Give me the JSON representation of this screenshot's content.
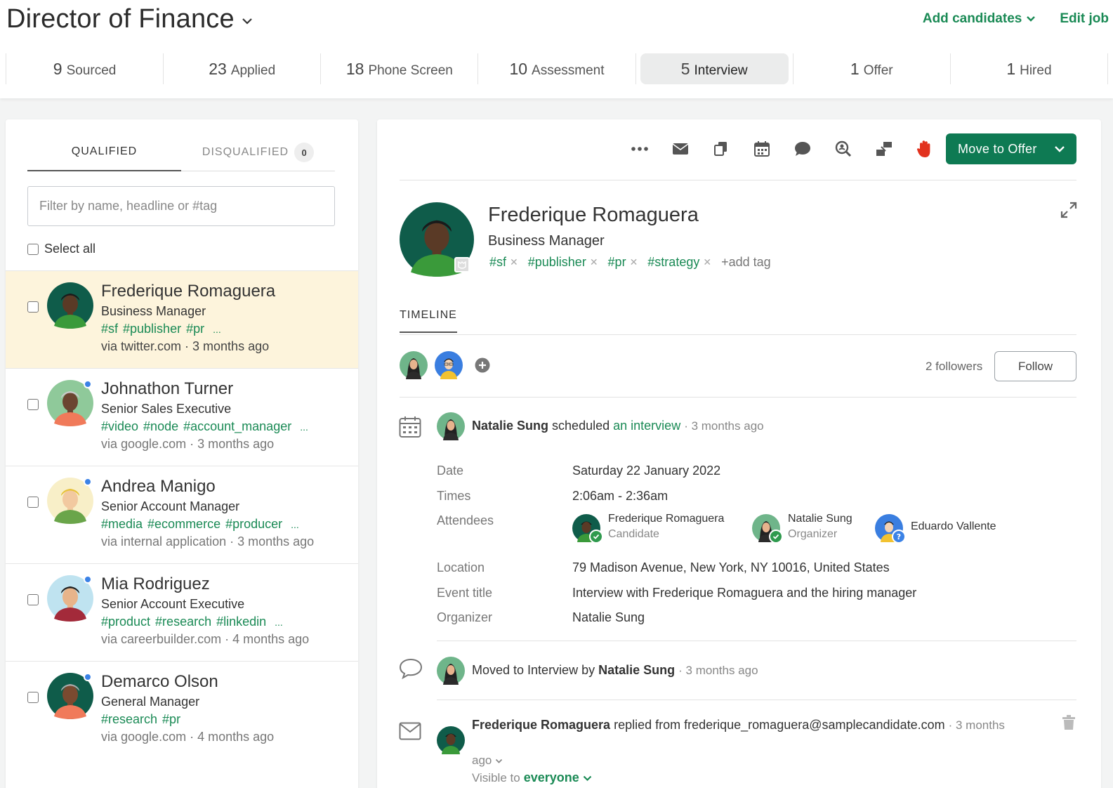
{
  "header": {
    "job_title": "Director of Finance",
    "add_candidates": "Add candidates",
    "edit_job": "Edit job"
  },
  "stages": [
    {
      "count": "9",
      "label": "Sourced"
    },
    {
      "count": "23",
      "label": "Applied"
    },
    {
      "count": "18",
      "label": "Phone Screen"
    },
    {
      "count": "10",
      "label": "Assessment"
    },
    {
      "count": "5",
      "label": "Interview",
      "active": true
    },
    {
      "count": "1",
      "label": "Offer"
    },
    {
      "count": "1",
      "label": "Hired"
    }
  ],
  "left": {
    "tab_qualified": "QUALIFIED",
    "tab_disqualified": "DISQUALIFIED",
    "disqualified_count": "0",
    "filter_placeholder": "Filter by name, headline or #tag",
    "select_all": "Select all",
    "candidates": [
      {
        "name": "Frederique Romaguera",
        "headline": "Business Manager",
        "tags": "#sf #publisher #pr",
        "more": "...",
        "source": "via twitter.com · 3 months ago",
        "selected": true,
        "new": false,
        "skin": "#5a3a26",
        "shirt": "#3a9a3a",
        "bg": "#0f5c4a",
        "hair": "#1a1a1a"
      },
      {
        "name": "Johnathon Turner",
        "headline": "Senior Sales Executive",
        "tags": "#video #node #account_manager",
        "more": "...",
        "source": "via google.com · 3 months ago",
        "selected": false,
        "new": true,
        "skin": "#6b4430",
        "shirt": "#f07a5a",
        "bg": "#8fc99a",
        "hair": "#c9c9c9"
      },
      {
        "name": "Andrea Manigo",
        "headline": "Senior Account Manager",
        "tags": "#media #ecommerce #producer",
        "more": "...",
        "source": "via internal application · 3 months ago",
        "selected": false,
        "new": true,
        "skin": "#f2c9a0",
        "shirt": "#6aa54a",
        "bg": "#f8efc8",
        "hair": "#e8c13a"
      },
      {
        "name": "Mia Rodriguez",
        "headline": "Senior Account Executive",
        "tags": "#product #research #linkedin",
        "more": "...",
        "source": "via careerbuilder.com · 4 months ago",
        "selected": false,
        "new": true,
        "skin": "#e8b48a",
        "shirt": "#a32a3a",
        "bg": "#bfe3f0",
        "hair": "#222222"
      },
      {
        "name": "Demarco Olson",
        "headline": "General Manager",
        "tags": "#research #pr",
        "more": "",
        "source": "via google.com · 4 months ago",
        "selected": false,
        "new": true,
        "skin": "#7a4a30",
        "shirt": "#f07a5a",
        "bg": "#0f5c4a",
        "hair": "#a8a8a8"
      }
    ]
  },
  "toolbar": {
    "icons": [
      "more-icon",
      "email-icon",
      "copy-icon",
      "calendar-icon",
      "comment-icon",
      "search-candidate-icon",
      "transfer-icon",
      "disqualify-hand-icon"
    ],
    "move_button": "Move to Offer"
  },
  "profile": {
    "name": "Frederique Romaguera",
    "headline": "Business Manager",
    "tags": [
      "#sf",
      "#publisher",
      "#pr",
      "#strategy"
    ],
    "add_tag": "add tag"
  },
  "timeline": {
    "tab": "TIMELINE",
    "followers_count": "2 followers",
    "follow_button": "Follow",
    "event1": {
      "actor": "Natalie Sung",
      "verb": "scheduled",
      "link": "an interview",
      "ago": "· 3 months ago",
      "details": {
        "date_label": "Date",
        "date_value": "Saturday 22 January 2022",
        "times_label": "Times",
        "times_value": "2:06am - 2:36am",
        "attendees_label": "Attendees",
        "attendees": [
          {
            "name": "Frederique Romaguera",
            "role": "Candidate",
            "status": "accepted"
          },
          {
            "name": "Natalie Sung",
            "role": "Organizer",
            "status": "accepted"
          },
          {
            "name": "Eduardo Vallente",
            "role": "",
            "status": "unknown"
          }
        ],
        "location_label": "Location",
        "location_value": "79 Madison Avenue, New York, NY 10016, United States",
        "event_title_label": "Event title",
        "event_title_value": "Interview with Frederique Romaguera and the hiring manager",
        "organizer_label": "Organizer",
        "organizer_value": "Natalie Sung"
      }
    },
    "event2": {
      "text": "Moved to Interview by",
      "actor": "Natalie Sung",
      "ago": "· 3 months ago"
    },
    "event3": {
      "actor": "Frederique Romaguera",
      "text": "replied from frederique_romaguera@samplecandidate.com",
      "ago": "· 3 months",
      "ago2": "ago",
      "visible_to": "Visible to",
      "visibility": "everyone"
    }
  },
  "colors": {
    "brand_green": "#0e7a53",
    "tag_green": "#1a8a55",
    "selected_row": "#fdf4dc",
    "new_dot": "#3b82e6",
    "hand_red": "#e2321e"
  }
}
